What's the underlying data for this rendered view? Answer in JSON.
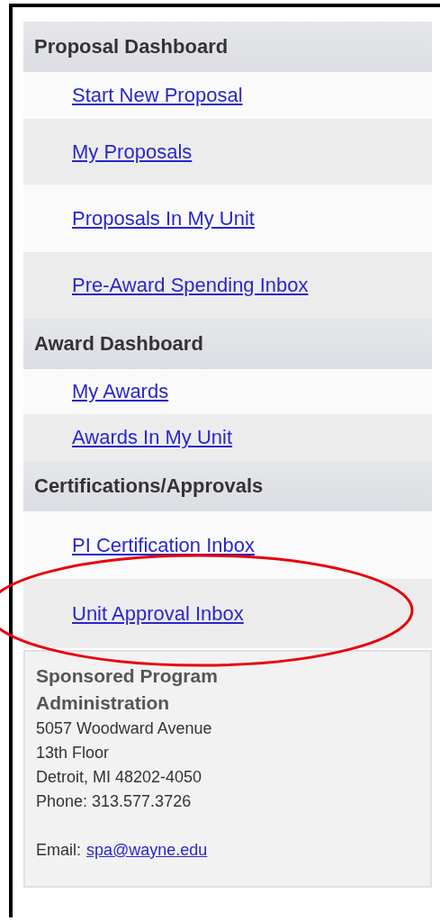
{
  "sections": [
    {
      "title": "Proposal Dashboard",
      "links": [
        {
          "label": "Start New Proposal",
          "highlighted": false
        },
        {
          "label": "My Proposals",
          "highlighted": false
        },
        {
          "label": "Proposals In My Unit",
          "highlighted": false
        },
        {
          "label": "Pre-Award Spending Inbox",
          "highlighted": false
        }
      ]
    },
    {
      "title": "Award Dashboard",
      "links": [
        {
          "label": "My Awards",
          "highlighted": false
        },
        {
          "label": "Awards In My Unit",
          "highlighted": false
        }
      ]
    },
    {
      "title": "Certifications/Approvals",
      "links": [
        {
          "label": "PI Certification Inbox",
          "highlighted": false
        },
        {
          "label": "Unit Approval Inbox",
          "highlighted": true
        }
      ]
    }
  ],
  "contact": {
    "organization": "Sponsored Program Administration",
    "address_lines": [
      "5057 Woodward Avenue",
      "13th Floor",
      "Detroit, MI 48202-4050",
      "Phone: 313.577.3726"
    ],
    "email_label": "Email:",
    "email": "spa@wayne.edu"
  }
}
